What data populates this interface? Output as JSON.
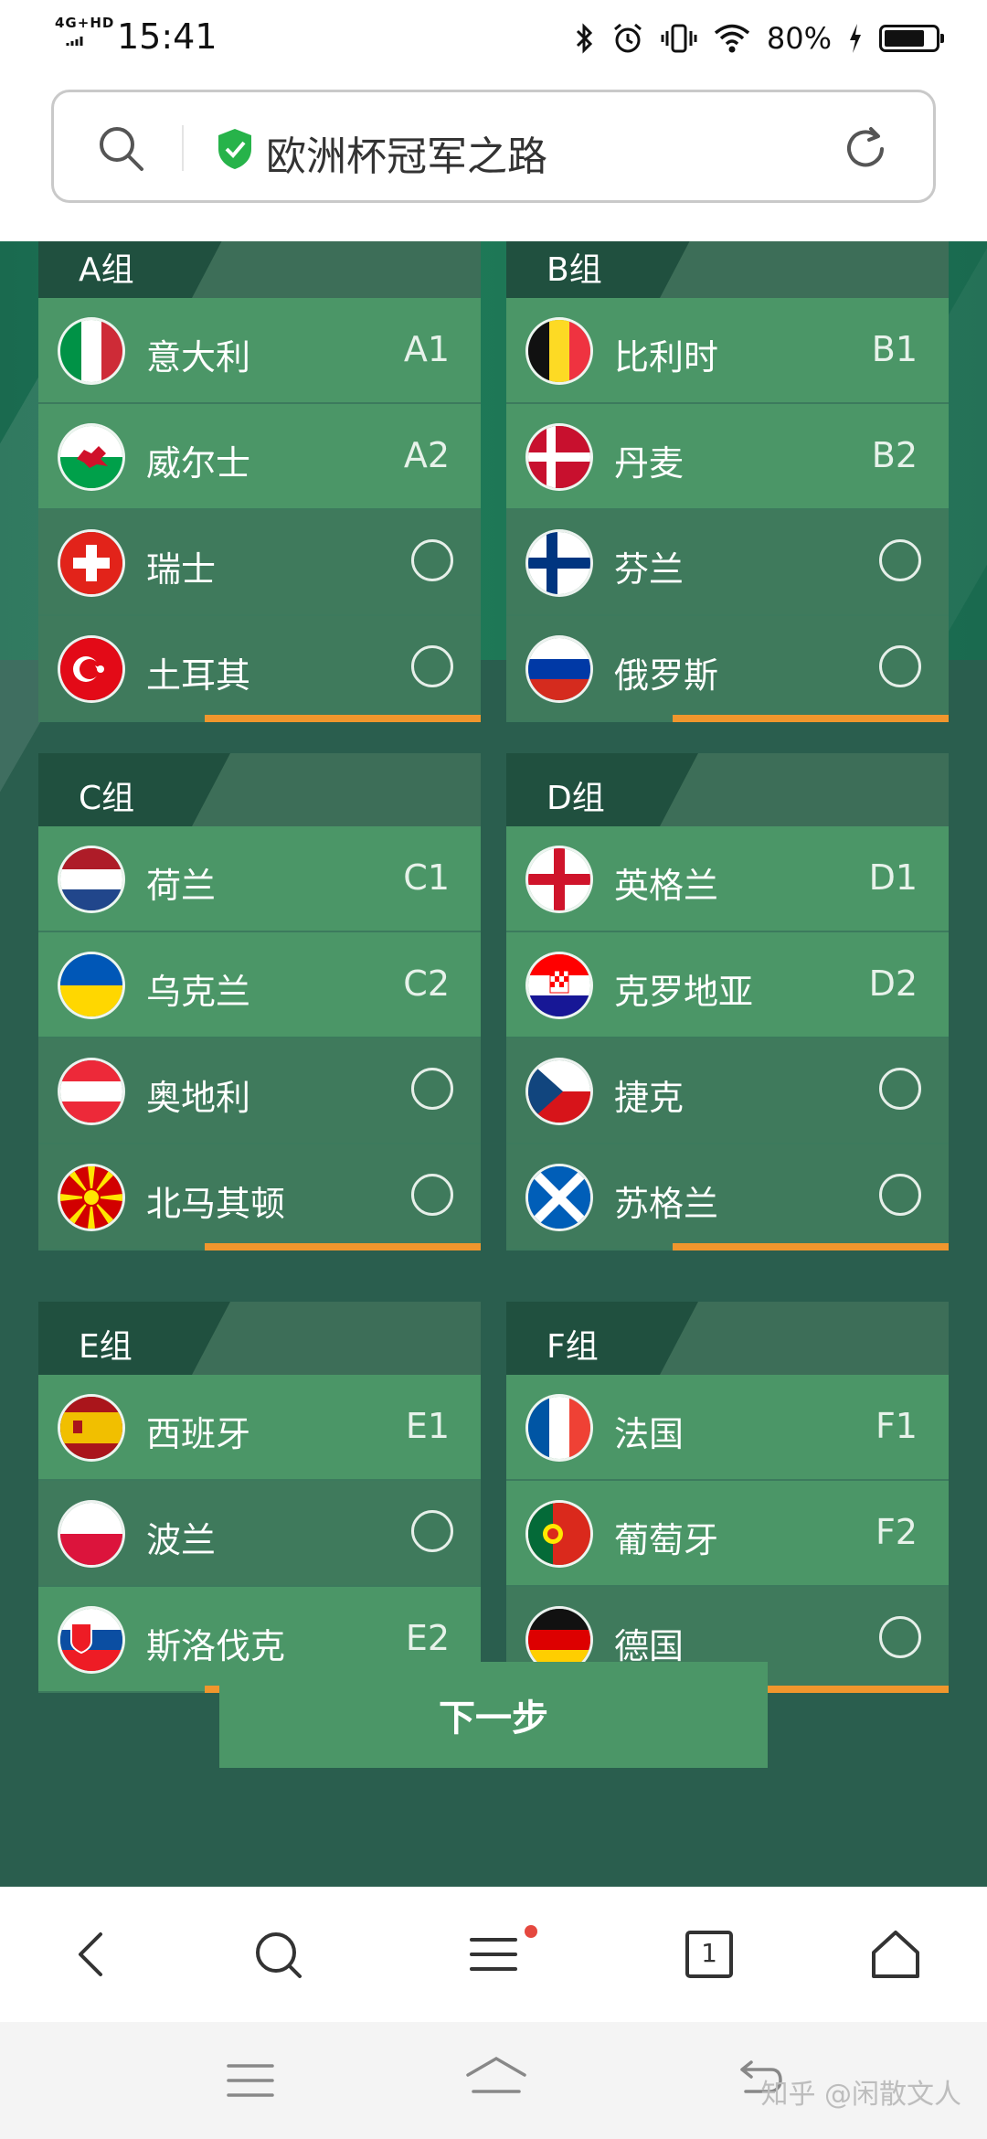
{
  "status_bar": {
    "network": "4G+HD",
    "time": "15:41",
    "battery": "80%",
    "battery_level": 0.8
  },
  "address_bar": {
    "url_text": "欧洲杯冠军之路"
  },
  "groups": [
    {
      "name": "A组",
      "teams": [
        {
          "name": "意大利",
          "pos": "A1",
          "flag": "italy",
          "state": "qualified"
        },
        {
          "name": "威尔士",
          "pos": "A2",
          "flag": "wales",
          "state": "qualified"
        },
        {
          "name": "瑞士",
          "pos": "",
          "flag": "switzerland",
          "state": "pending"
        },
        {
          "name": "土耳其",
          "pos": "",
          "flag": "turkey",
          "state": "pending"
        }
      ]
    },
    {
      "name": "B组",
      "teams": [
        {
          "name": "比利时",
          "pos": "B1",
          "flag": "belgium",
          "state": "qualified"
        },
        {
          "name": "丹麦",
          "pos": "B2",
          "flag": "denmark",
          "state": "qualified"
        },
        {
          "name": "芬兰",
          "pos": "",
          "flag": "finland",
          "state": "pending"
        },
        {
          "name": "俄罗斯",
          "pos": "",
          "flag": "russia",
          "state": "pending"
        }
      ]
    },
    {
      "name": "C组",
      "teams": [
        {
          "name": "荷兰",
          "pos": "C1",
          "flag": "netherlands",
          "state": "qualified"
        },
        {
          "name": "乌克兰",
          "pos": "C2",
          "flag": "ukraine",
          "state": "qualified"
        },
        {
          "name": "奥地利",
          "pos": "",
          "flag": "austria",
          "state": "pending"
        },
        {
          "name": "北马其顿",
          "pos": "",
          "flag": "north-macedonia",
          "state": "pending"
        }
      ]
    },
    {
      "name": "D组",
      "teams": [
        {
          "name": "英格兰",
          "pos": "D1",
          "flag": "england",
          "state": "qualified"
        },
        {
          "name": "克罗地亚",
          "pos": "D2",
          "flag": "croatia",
          "state": "qualified"
        },
        {
          "name": "捷克",
          "pos": "",
          "flag": "czech",
          "state": "pending"
        },
        {
          "name": "苏格兰",
          "pos": "",
          "flag": "scotland",
          "state": "pending"
        }
      ]
    },
    {
      "name": "E组",
      "teams": [
        {
          "name": "西班牙",
          "pos": "E1",
          "flag": "spain",
          "state": "qualified"
        },
        {
          "name": "波兰",
          "pos": "",
          "flag": "poland",
          "state": "pending"
        },
        {
          "name": "斯洛伐克",
          "pos": "E2",
          "flag": "slovakia",
          "state": "qualified"
        }
      ]
    },
    {
      "name": "F组",
      "teams": [
        {
          "name": "法国",
          "pos": "F1",
          "flag": "france",
          "state": "qualified"
        },
        {
          "name": "葡萄牙",
          "pos": "F2",
          "flag": "portugal",
          "state": "qualified"
        },
        {
          "name": "德国",
          "pos": "",
          "flag": "germany",
          "state": "pending"
        }
      ]
    }
  ],
  "next_button": "下一步",
  "tab_count": "1",
  "watermark": "知乎 @闲散文人",
  "colors": {
    "qualified_row": "#4b9667",
    "pending_row": "#3f7a5c",
    "accent": "#f0962d",
    "header_tab": "#20503f"
  }
}
